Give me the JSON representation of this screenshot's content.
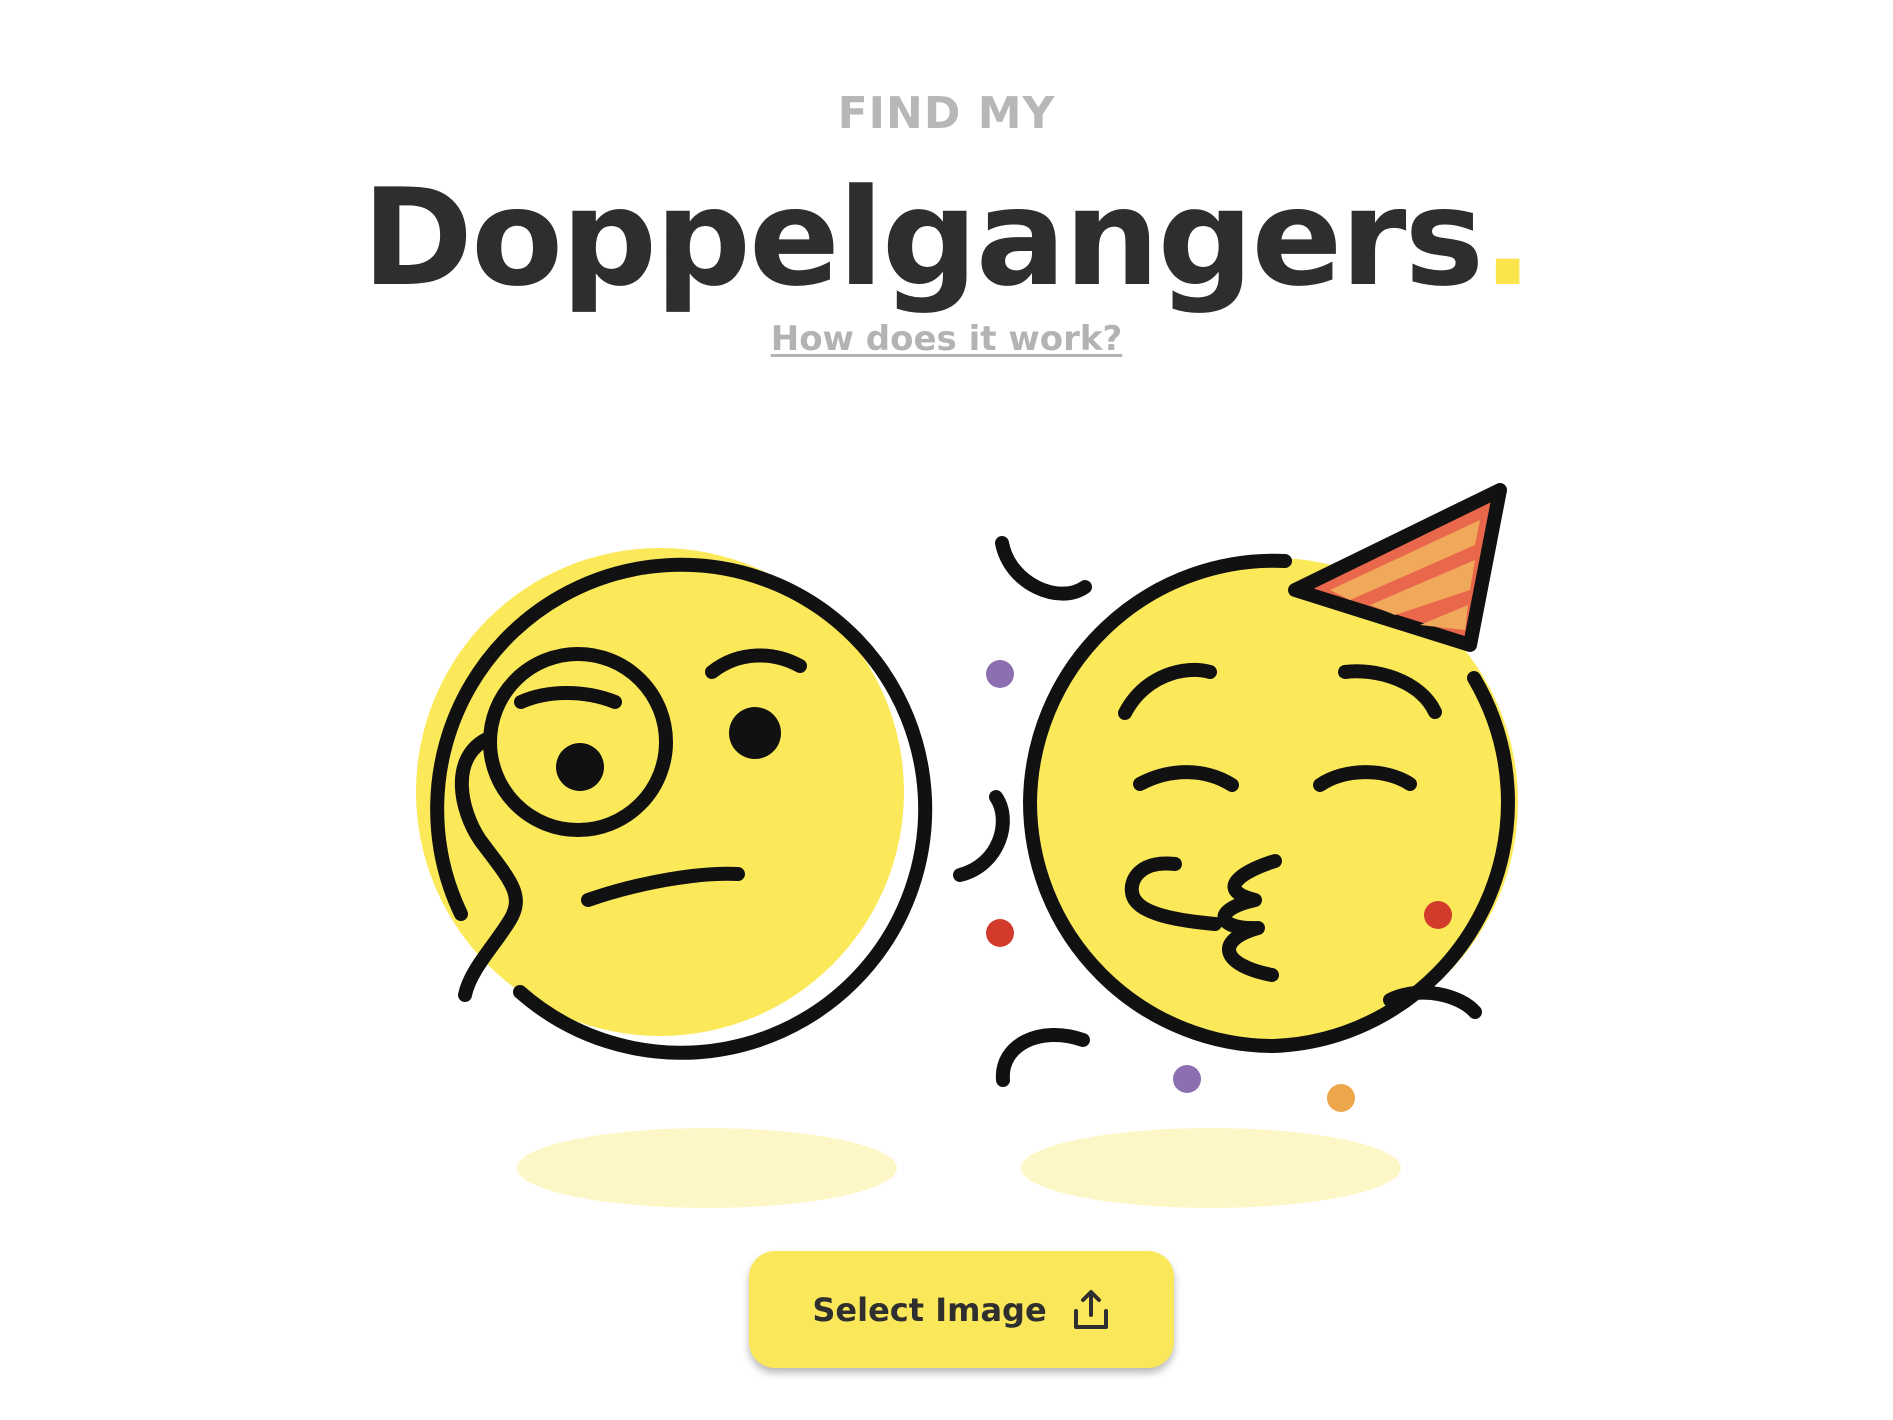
{
  "header": {
    "eyebrow": "FIND MY",
    "title": "Doppelgangers",
    "title_dot": ".",
    "how_link": "How does it work?"
  },
  "illustration": {
    "left_emoji": "monocle-face-icon",
    "right_emoji": "partying-kiss-face-icon",
    "party_hat": "party-hat-icon",
    "confetti": "confetti-icon"
  },
  "action": {
    "select_label": "Select Image",
    "select_icon": "upload-icon"
  },
  "colors": {
    "accent": "#fbe44c",
    "button": "#fbe85a",
    "face": "#fce95a",
    "shadow": "#fdf7c8",
    "title": "#2e2e2e",
    "muted": "#b7b7b7",
    "confetti_purple": "#8b6fb0",
    "confetti_red": "#d23b2b",
    "confetti_orange": "#eda64a"
  }
}
